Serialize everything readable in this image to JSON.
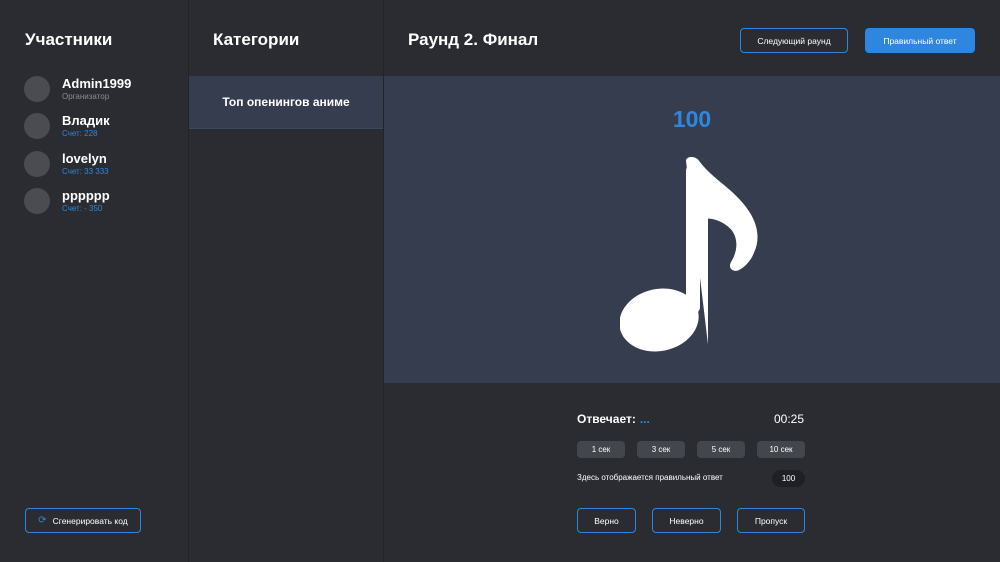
{
  "participants": {
    "title": "Участники",
    "items": [
      {
        "name": "Admin1999",
        "sub": "Организатор"
      },
      {
        "name": "Владик",
        "sub": "Счет: 228"
      },
      {
        "name": "lovelyn",
        "sub": "Счет: 33 333"
      },
      {
        "name": "pppppp",
        "sub": "Счет: - 350"
      }
    ],
    "generate_label": "Сгенерировать код"
  },
  "categories": {
    "title": "Категории",
    "items": [
      {
        "label": "Топ опенингов аниме"
      }
    ]
  },
  "main": {
    "title": "Раунд 2. Финал",
    "next_round_label": "Следующий раунд",
    "correct_answer_label": "Правильный ответ",
    "stage_value": "100",
    "answering_label": "Отвечает:",
    "answering_value": "...",
    "timer": "00:25",
    "time_options": [
      "1 сек",
      "3 сек",
      "5 сек",
      "10 сек"
    ],
    "answer_hint": "Здесь отображается правильный ответ",
    "answer_value": "100",
    "judge": {
      "right": "Верно",
      "wrong": "Неверно",
      "skip": "Пропуск"
    }
  },
  "colors": {
    "accent": "#2f86de",
    "panel": "#363d4e",
    "background": "#2b2c31"
  }
}
